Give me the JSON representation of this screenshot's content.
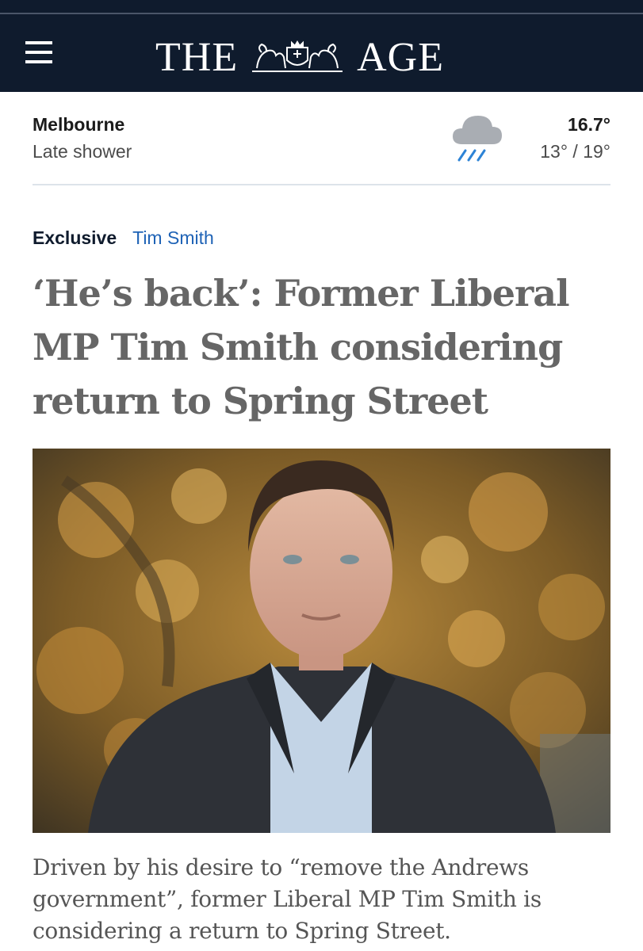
{
  "header": {
    "masthead_left": "THE",
    "masthead_right": "AGE",
    "menu_icon": "hamburger-menu-icon",
    "crest_icon": "coat-of-arms-icon",
    "background": "#0f1b2d"
  },
  "weather": {
    "city": "Melbourne",
    "condition": "Late shower",
    "icon": "rain-cloud-icon",
    "current_temp": "16.7°",
    "range": "13° / 19°"
  },
  "article": {
    "label": "Exclusive",
    "tag": "Tim Smith",
    "tag_color": "#1f63b6",
    "headline": "‘He’s back’: Former Liberal MP Tim Smith considering return to Spring Street",
    "standfirst": "Driven by his desire to “remove the Andrews government”, former Liberal MP Tim Smith is considering a return to Spring Street."
  }
}
